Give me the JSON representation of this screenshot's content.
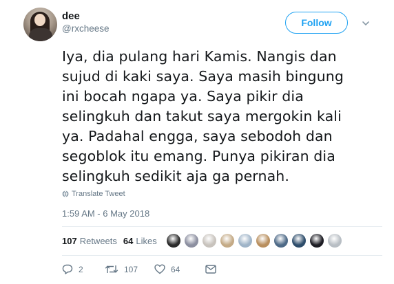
{
  "user": {
    "display_name": "dee",
    "handle": "@rxcheese",
    "avatar_icon": "user-avatar"
  },
  "follow_label": "Follow",
  "tweet": {
    "lines": [
      "Iya, dia pulang hari Kamis. Nangis dan",
      "sujud di kaki saya. Saya masih bingung",
      "ini bocah ngapa ya. Saya pikir dia",
      "selingkuh dan takut saya mergokin kali",
      "ya. Padahal engga, saya sebodoh dan",
      "segoblok itu emang. Punya pikiran dia",
      "selingkuh sedikit aja ga pernah."
    ],
    "translate_label": "Translate Tweet",
    "timestamp": "1:59 AM - 6 May 2018"
  },
  "stats": {
    "retweets_count": "107",
    "retweets_label": "Retweets",
    "likes_count": "64",
    "likes_label": "Likes"
  },
  "liker_avatars": [
    "#2b2b2b",
    "#8c8fa0",
    "#c8c3bd",
    "#c4aa86",
    "#9fb4c8",
    "#b98f5e",
    "#4e6a87",
    "#2e4d6b",
    "#1d1d24",
    "#b8bec4"
  ],
  "actions": {
    "reply_count": "2",
    "retweet_count": "107",
    "like_count": "64"
  },
  "colors": {
    "accent": "#1da1f2",
    "muted": "#657786",
    "text": "#14171a"
  }
}
